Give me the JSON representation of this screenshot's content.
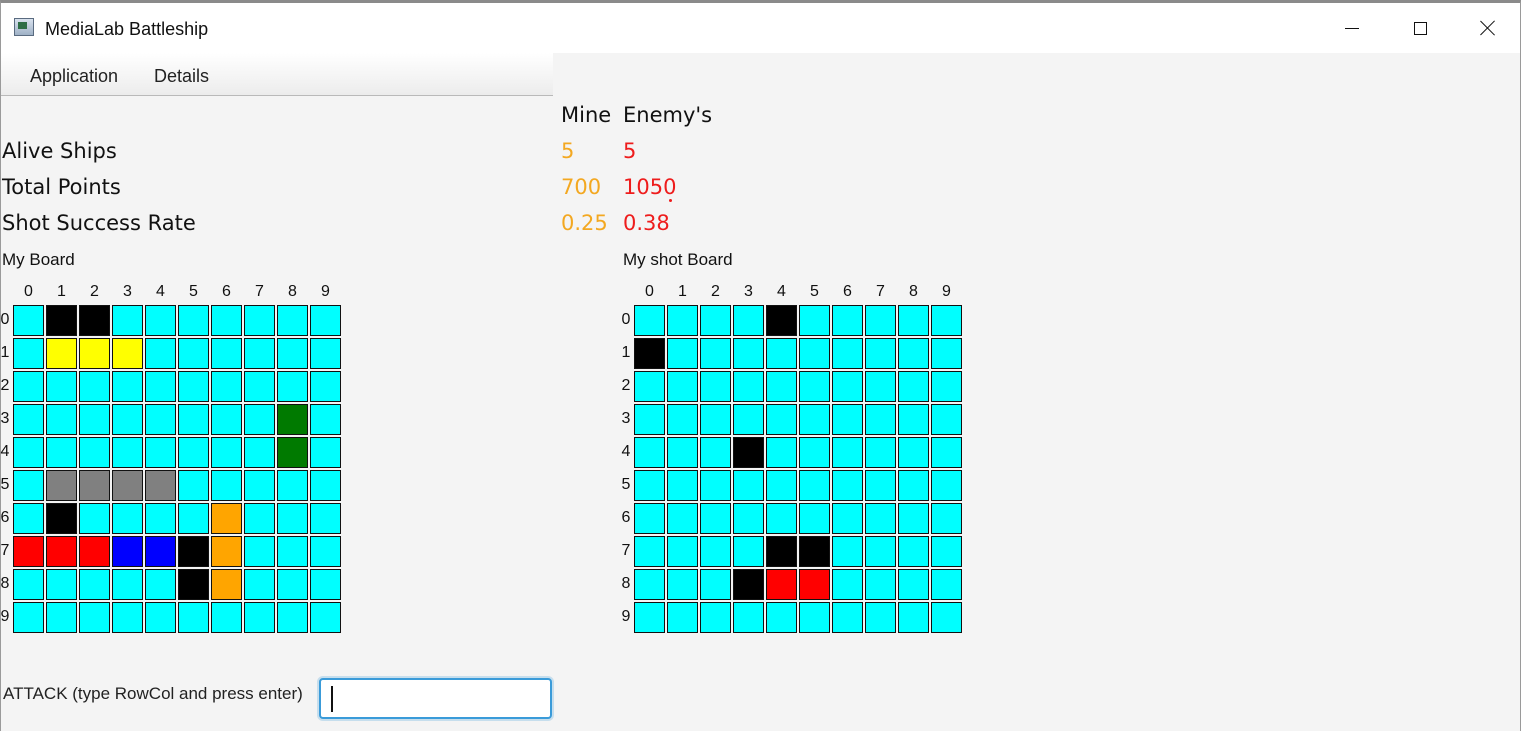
{
  "window": {
    "title": "MediaLab Battleship"
  },
  "menu": {
    "items": [
      "Application",
      "Details"
    ]
  },
  "stats": {
    "headers": {
      "mine": "Mine",
      "enemy": "Enemy's"
    },
    "rows": [
      {
        "label": "Alive Ships",
        "mine": "5",
        "enemy": "5"
      },
      {
        "label": "Total Points",
        "mine": "700",
        "enemy": "1050"
      },
      {
        "label": "Shot Success Rate",
        "mine": "0.25",
        "enemy": "0.38"
      }
    ],
    "colors": {
      "mine": "#f3a821",
      "enemy": "#ee1c1c"
    }
  },
  "boards": {
    "my": {
      "label": "My Board",
      "col_labels": [
        "0",
        "1",
        "2",
        "3",
        "4",
        "5",
        "6",
        "7",
        "8",
        "9"
      ],
      "row_labels": [
        "0",
        "1",
        "2",
        "3",
        "4",
        "5",
        "6",
        "7",
        "8",
        "9"
      ],
      "cells": [
        [
          "C",
          "K",
          "K",
          "C",
          "C",
          "C",
          "C",
          "C",
          "C",
          "C"
        ],
        [
          "C",
          "Y",
          "Y",
          "Y",
          "C",
          "C",
          "C",
          "C",
          "C",
          "C"
        ],
        [
          "C",
          "C",
          "C",
          "C",
          "C",
          "C",
          "C",
          "C",
          "C",
          "C"
        ],
        [
          "C",
          "C",
          "C",
          "C",
          "C",
          "C",
          "C",
          "C",
          "G",
          "C"
        ],
        [
          "C",
          "C",
          "C",
          "C",
          "C",
          "C",
          "C",
          "C",
          "G",
          "C"
        ],
        [
          "C",
          "A",
          "A",
          "A",
          "A",
          "C",
          "C",
          "C",
          "C",
          "C"
        ],
        [
          "C",
          "K",
          "C",
          "C",
          "C",
          "C",
          "O",
          "C",
          "C",
          "C"
        ],
        [
          "R",
          "R",
          "R",
          "B",
          "B",
          "K",
          "O",
          "C",
          "C",
          "C"
        ],
        [
          "C",
          "C",
          "C",
          "C",
          "C",
          "K",
          "O",
          "C",
          "C",
          "C"
        ],
        [
          "C",
          "C",
          "C",
          "C",
          "C",
          "C",
          "C",
          "C",
          "C",
          "C"
        ]
      ]
    },
    "shot": {
      "label": "My shot Board",
      "col_labels": [
        "0",
        "1",
        "2",
        "3",
        "4",
        "5",
        "6",
        "7",
        "8",
        "9"
      ],
      "row_labels": [
        "0",
        "1",
        "2",
        "3",
        "4",
        "5",
        "6",
        "7",
        "8",
        "9"
      ],
      "cells": [
        [
          "C",
          "C",
          "C",
          "C",
          "K",
          "C",
          "C",
          "C",
          "C",
          "C"
        ],
        [
          "K",
          "C",
          "C",
          "C",
          "C",
          "C",
          "C",
          "C",
          "C",
          "C"
        ],
        [
          "C",
          "C",
          "C",
          "C",
          "C",
          "C",
          "C",
          "C",
          "C",
          "C"
        ],
        [
          "C",
          "C",
          "C",
          "C",
          "C",
          "C",
          "C",
          "C",
          "C",
          "C"
        ],
        [
          "C",
          "C",
          "C",
          "K",
          "C",
          "C",
          "C",
          "C",
          "C",
          "C"
        ],
        [
          "C",
          "C",
          "C",
          "C",
          "C",
          "C",
          "C",
          "C",
          "C",
          "C"
        ],
        [
          "C",
          "C",
          "C",
          "C",
          "C",
          "C",
          "C",
          "C",
          "C",
          "C"
        ],
        [
          "C",
          "C",
          "C",
          "C",
          "K",
          "K",
          "C",
          "C",
          "C",
          "C"
        ],
        [
          "C",
          "C",
          "C",
          "K",
          "R",
          "R",
          "C",
          "C",
          "C",
          "C"
        ],
        [
          "C",
          "C",
          "C",
          "C",
          "C",
          "C",
          "C",
          "C",
          "C",
          "C"
        ]
      ]
    },
    "palette": {
      "C": "#00ffff",
      "K": "#000000",
      "Y": "#ffff00",
      "G": "#007a00",
      "A": "#808080",
      "O": "#ffa500",
      "R": "#ff0000",
      "B": "#0000ff"
    }
  },
  "attack": {
    "label": "ATTACK (type RowCol and press enter)",
    "value": ""
  }
}
